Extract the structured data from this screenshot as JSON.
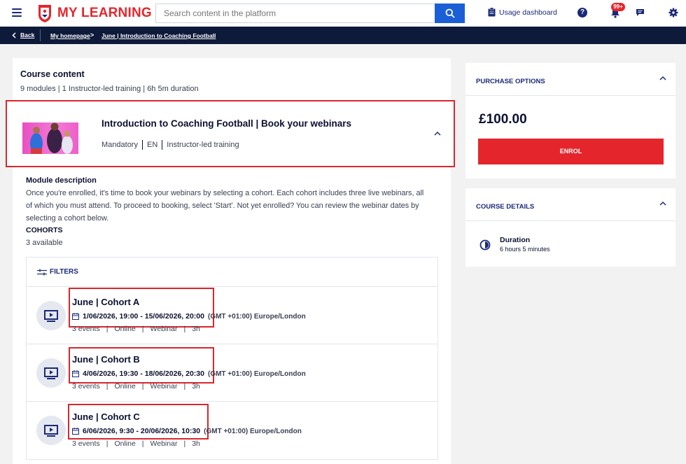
{
  "app": {
    "title": "MY LEARNING",
    "search_placeholder": "Search content in the platform",
    "usage_label": "Usage dashboard",
    "notification_count": "99+"
  },
  "breadcrumb": {
    "back": "Back",
    "home": "My homepage",
    "current": "June | Introduction to Coaching Football"
  },
  "course": {
    "section_title": "Course content",
    "meta": "9 modules | 1 Instructor-led training | 6h 5m duration",
    "module": {
      "title": "Introduction to Coaching Football | Book your webinars",
      "tags": [
        "Mandatory",
        "EN",
        "Instructor-led training"
      ]
    },
    "description_title": "Module description",
    "description": "Once you're enrolled, it's time to book your webinars by selecting a cohort. Each cohort includes three live webinars, all of which you must attend. To proceed to booking, select 'Start'. Not yet enrolled? You can review the webinar dates by selecting a cohort below.",
    "cohorts_title": "COHORTS",
    "cohorts_count": "3 available",
    "filters_label": "FILTERS",
    "cohorts": [
      {
        "title": "June | Cohort A",
        "dates": "1/06/2026, 19:00 - 15/06/2026, 20:00",
        "tz": "(GMT +01:00) Europe/London",
        "tags": [
          "3 events",
          "Online",
          "Webinar",
          "3h"
        ]
      },
      {
        "title": "June | Cohort B",
        "dates": "4/06/2026, 19:30 - 18/06/2026, 20:30",
        "tz": "(GMT +01:00) Europe/London",
        "tags": [
          "3 events",
          "Online",
          "Webinar",
          "3h"
        ]
      },
      {
        "title": "June | Cohort C",
        "dates": "6/06/2026, 9:30 - 20/06/2026, 10:30",
        "tz": "(GMT +01:00) Europe/London",
        "tags": [
          "3 events",
          "Online",
          "Webinar",
          "3h"
        ]
      }
    ]
  },
  "purchase": {
    "heading": "PURCHASE OPTIONS",
    "price": "£100.00",
    "enrol_label": "ENROL"
  },
  "details": {
    "heading": "COURSE DETAILS",
    "duration_label": "Duration",
    "duration_value": "6 hours 5 minutes"
  },
  "colors": {
    "brand_red": "#e4262c",
    "navy": "#1b2a78",
    "search_blue": "#1b5fd6",
    "dark_bar": "#0e1a3a",
    "highlight_red": "#d6272e"
  }
}
